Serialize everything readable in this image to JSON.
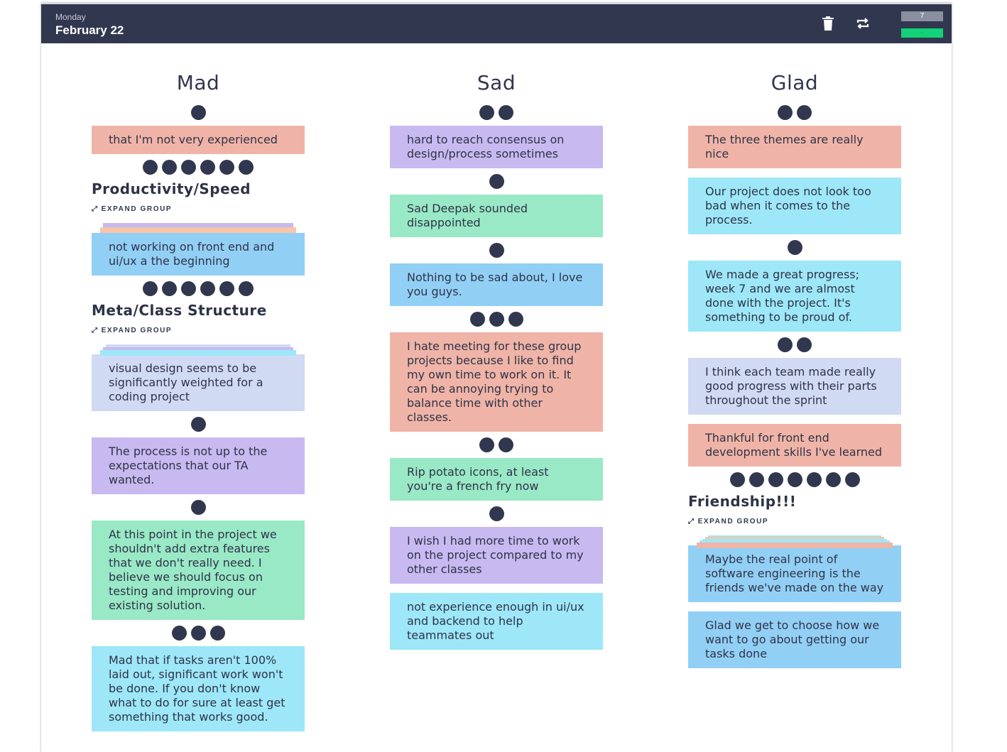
{
  "header": {
    "day": "Monday",
    "date": "February 22",
    "counter": "7",
    "ready": "-"
  },
  "columns": [
    {
      "title": "Mad",
      "items": [
        {
          "votes": 1
        },
        {
          "note": "that I'm not very experienced",
          "color": "#efb4a7"
        },
        {
          "votes": 6
        },
        {
          "group_title": "Productivity/Speed",
          "expand": "EXPAND GROUP"
        },
        {
          "note": "not working on front end and ui/ux a the beginning",
          "color": "#92cff5"
        },
        {
          "votes": 6
        },
        {
          "group_title": "Meta/Class Structure",
          "expand": "EXPAND GROUP"
        },
        {
          "note": "visual design seems to be significantly weighted for a coding project",
          "color": "#d1daf3"
        },
        {
          "votes": 1
        },
        {
          "note": "The process is not up to the expectations that our TA wanted.",
          "color": "#c8b9f0"
        },
        {
          "votes": 1
        },
        {
          "note": "At this point in the project we shouldn't add extra features that we don't really need. I believe we should focus on testing and improving our existing solution.",
          "color": "#99e8c6"
        },
        {
          "votes": 3
        },
        {
          "note": "Mad that if tasks aren't 100% laid out, significant work won't be done. If you don't know what to do for sure at least get something that works good.",
          "color": "#9de7f8"
        }
      ]
    },
    {
      "title": "Sad",
      "items": [
        {
          "votes": 2
        },
        {
          "note": "hard to reach consensus on design/process sometimes",
          "color": "#c8b9f0"
        },
        {
          "votes": 1
        },
        {
          "note": "Sad Deepak sounded disappointed",
          "color": "#99e8c6"
        },
        {
          "votes": 1
        },
        {
          "note": "Nothing to be sad about, I love you guys.",
          "color": "#92cff5"
        },
        {
          "votes": 3
        },
        {
          "note": "I hate meeting for these group projects because I like to find my own time to work on it. It can be annoying trying to balance time with other classes.",
          "color": "#efb4a7"
        },
        {
          "votes": 2
        },
        {
          "note": "Rip potato icons, at least you're a french fry now",
          "color": "#99e8c6"
        },
        {
          "votes": 1
        },
        {
          "note": "I wish I had more time to work on the project compared to my other classes",
          "color": "#c8b9f0"
        },
        {
          "note": "not experience enough in ui/ux and backend to help teammates out",
          "color": "#9de7f8"
        }
      ]
    },
    {
      "title": "Glad",
      "items": [
        {
          "votes": 2
        },
        {
          "note": "The three themes are really nice",
          "color": "#efb4a7"
        },
        {
          "note": "Our project does not look too bad when it comes to the process.",
          "color": "#9de7f8"
        },
        {
          "votes": 1
        },
        {
          "note": "We made a great progress; week 7 and we are almost done with the project. It's something to be proud of.",
          "color": "#9de7f8"
        },
        {
          "votes": 2
        },
        {
          "note": "I think each team made really good progress with their parts throughout the sprint",
          "color": "#d1daf3"
        },
        {
          "note": "Thankful for front end development skills I've learned",
          "color": "#efb4a7"
        },
        {
          "votes": 7
        },
        {
          "group_title": "Friendship!!!",
          "expand": "EXPAND GROUP"
        },
        {
          "note": "Maybe the real point of software engineering is the friends we've made on the way",
          "color": "#92cff5"
        },
        {
          "note": "Glad we get to choose how we want to go about getting our tasks done",
          "color": "#92cff5"
        }
      ]
    }
  ]
}
